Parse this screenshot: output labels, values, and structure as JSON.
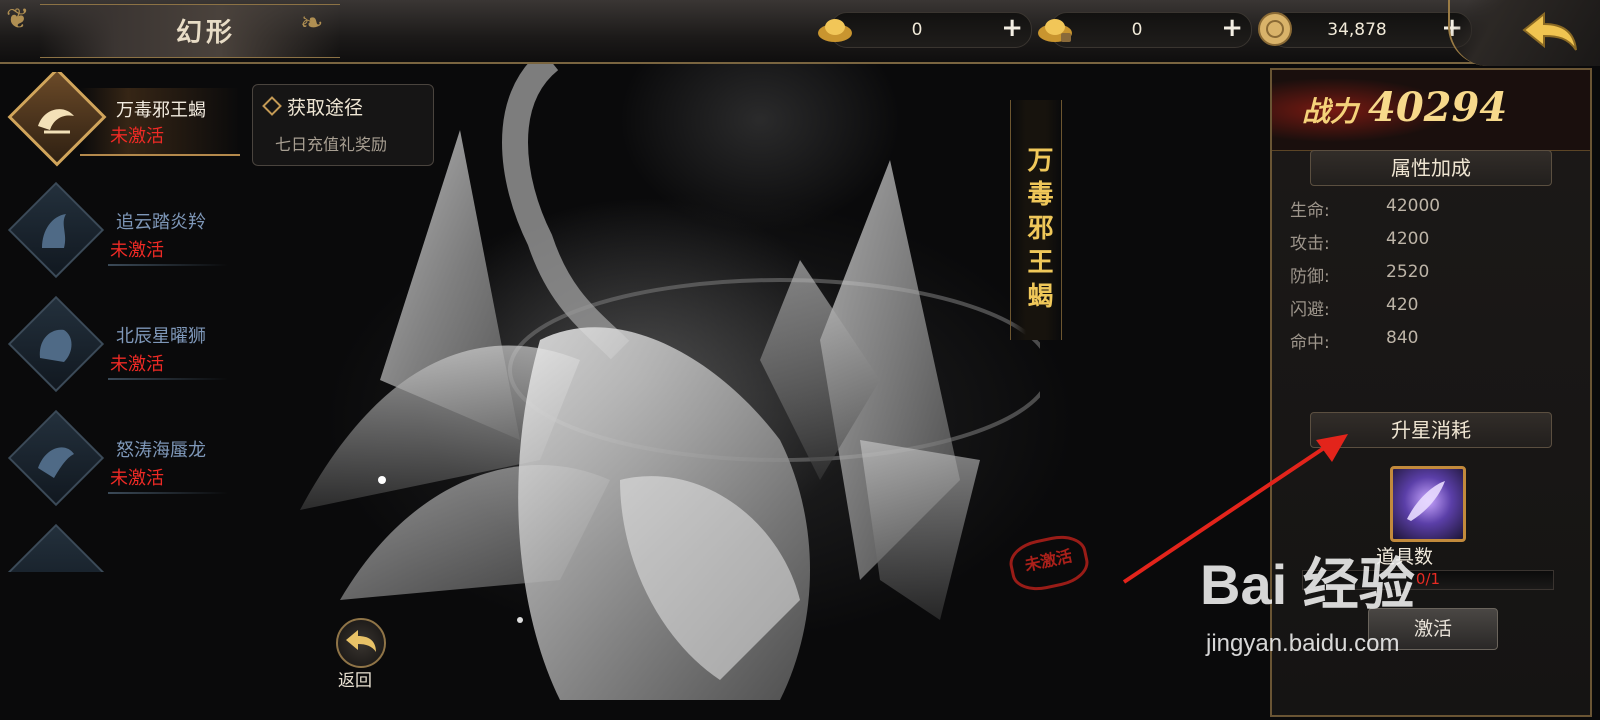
{
  "header": {
    "title": "幻形",
    "currencies": [
      {
        "icon": "gold-ingot-icon",
        "value": "0"
      },
      {
        "icon": "bound-gold-ingot-icon",
        "value": "0"
      },
      {
        "icon": "coin-icon",
        "value": "34,878"
      }
    ],
    "plus": "+"
  },
  "forms": [
    {
      "name": "万毒邪王蝎",
      "state": "未激活",
      "active": true
    },
    {
      "name": "追云踏炎羚",
      "state": "未激活",
      "active": false
    },
    {
      "name": "北辰星曜狮",
      "state": "未激活",
      "active": false
    },
    {
      "name": "怒涛海蜃龙",
      "state": "未激活",
      "active": false
    },
    {
      "name": "",
      "state": "",
      "active": false
    }
  ],
  "acquire": {
    "title": "获取途径",
    "source": "七日充值礼奖励"
  },
  "showcase": {
    "name": "万毒邪王蝎",
    "stamp": "未激活",
    "return_label": "返回"
  },
  "panel": {
    "power_label": "战力",
    "power_value": "40294",
    "attr_title": "属性加成",
    "attributes": [
      {
        "name": "生命:",
        "value": "42000"
      },
      {
        "name": "攻击:",
        "value": "4200"
      },
      {
        "name": "防御:",
        "value": "2520"
      },
      {
        "name": "闪避:",
        "value": "420"
      },
      {
        "name": "命中:",
        "value": "840"
      }
    ],
    "cost_title": "升星消耗",
    "item_label": "道具数",
    "item_count": "0/1",
    "activate_label": "激活"
  },
  "watermark": {
    "brand": "Bai 经验",
    "url": "jingyan.baidu.com"
  },
  "colors": {
    "gold": "#d1a55b",
    "inactive_red": "#ee2a25",
    "annotation_red": "#e3241b"
  }
}
